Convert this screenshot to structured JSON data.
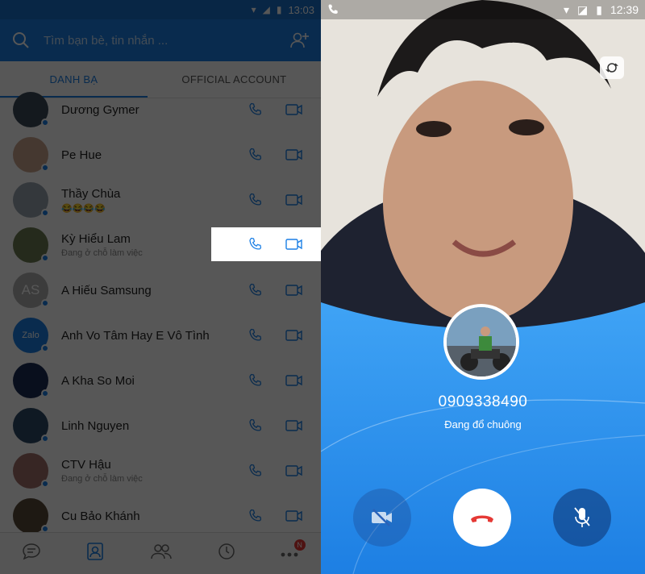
{
  "left": {
    "status_time": "13:03",
    "search_placeholder": "Tìm bạn bè, tin nhắn ...",
    "tabs": [
      "DANH BẠ",
      "OFFICIAL ACCOUNT"
    ],
    "contacts": [
      {
        "name": "Dương Gymer",
        "sub": "",
        "avatar_color": "#3b4a5a",
        "initials": ""
      },
      {
        "name": "Pe Hue",
        "sub": "",
        "avatar_color": "#c9a48e",
        "initials": ""
      },
      {
        "name": "Thầy Chùa",
        "sub": "😂😂😂😂",
        "avatar_color": "#9aa5b1",
        "initials": ""
      },
      {
        "name": "Kỳ Hiểu Lam",
        "sub": "Đang ở chỗ làm việc",
        "avatar_color": "#6e7d52",
        "initials": ""
      },
      {
        "name": "A Hiếu Samsung",
        "sub": "",
        "avatar_color": "#b0b0b0",
        "initials": "AS"
      },
      {
        "name": "Anh Vo Tâm Hay E Vô Tình",
        "sub": "",
        "avatar_color": "#1b7fe5",
        "initials": "Zalo"
      },
      {
        "name": "A Kha So Moi",
        "sub": "",
        "avatar_color": "#1d2d55",
        "initials": ""
      },
      {
        "name": "Linh Nguyen",
        "sub": "",
        "avatar_color": "#2e4a66",
        "initials": ""
      },
      {
        "name": "CTV Hậu",
        "sub": "Đang ở chỗ làm việc",
        "avatar_color": "#a26f6a",
        "initials": ""
      },
      {
        "name": "Cu Bảo Khánh",
        "sub": "",
        "avatar_color": "#5a4a3a",
        "initials": ""
      }
    ],
    "nav_badge": "N"
  },
  "right": {
    "status_time": "12:39",
    "phone_number": "0909338490",
    "call_status": "Đang đổ chuông"
  }
}
